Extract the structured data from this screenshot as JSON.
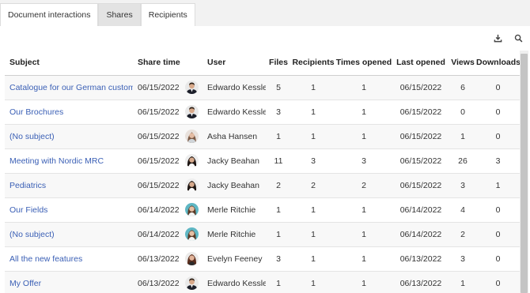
{
  "tabs": [
    {
      "label": "Document interactions",
      "active": false
    },
    {
      "label": "Shares",
      "active": true
    },
    {
      "label": "Recipients",
      "active": false
    }
  ],
  "toolbar": {
    "download_icon": "download-icon",
    "search_icon": "search-icon"
  },
  "columns": {
    "subject": "Subject",
    "share_time": "Share time",
    "user": "User",
    "files": "Files",
    "recipients": "Recipients",
    "times_opened": "Times opened",
    "last_opened": "Last opened",
    "views": "Views",
    "downloads": "Downloads"
  },
  "rows": [
    {
      "subject": "Catalogue for our German customers",
      "share_time": "06/15/2022",
      "user": "Edwardo Kessler",
      "avatar": "male-suit",
      "files": "5",
      "recipients": "1",
      "times_opened": "1",
      "last_opened": "06/15/2022",
      "views": "6",
      "downloads": "0"
    },
    {
      "subject": "Our Brochures",
      "share_time": "06/15/2022",
      "user": "Edwardo Kessler",
      "avatar": "male-suit",
      "files": "3",
      "recipients": "1",
      "times_opened": "1",
      "last_opened": "06/15/2022",
      "views": "0",
      "downloads": "0"
    },
    {
      "subject": "(No subject)",
      "share_time": "06/15/2022",
      "user": "Asha Hansen",
      "avatar": "female-light",
      "files": "1",
      "recipients": "1",
      "times_opened": "1",
      "last_opened": "06/15/2022",
      "views": "1",
      "downloads": "0"
    },
    {
      "subject": "Meeting with Nordic MRC",
      "share_time": "06/15/2022",
      "user": "Jacky Beahan",
      "avatar": "female-dark",
      "files": "11",
      "recipients": "3",
      "times_opened": "3",
      "last_opened": "06/15/2022",
      "views": "26",
      "downloads": "3"
    },
    {
      "subject": "Pediatrics",
      "share_time": "06/15/2022",
      "user": "Jacky Beahan",
      "avatar": "female-dark",
      "files": "2",
      "recipients": "2",
      "times_opened": "2",
      "last_opened": "06/15/2022",
      "views": "3",
      "downloads": "1"
    },
    {
      "subject": "Our Fields",
      "share_time": "06/14/2022",
      "user": "Merle Ritchie",
      "avatar": "female-teal",
      "files": "1",
      "recipients": "1",
      "times_opened": "1",
      "last_opened": "06/14/2022",
      "views": "4",
      "downloads": "0"
    },
    {
      "subject": "(No subject)",
      "share_time": "06/14/2022",
      "user": "Merle Ritchie",
      "avatar": "female-teal",
      "files": "1",
      "recipients": "1",
      "times_opened": "1",
      "last_opened": "06/14/2022",
      "views": "2",
      "downloads": "0"
    },
    {
      "subject": "All the new features",
      "share_time": "06/13/2022",
      "user": "Evelyn Feeney",
      "avatar": "female-brown",
      "files": "3",
      "recipients": "1",
      "times_opened": "1",
      "last_opened": "06/13/2022",
      "views": "3",
      "downloads": "0"
    },
    {
      "subject": "My Offer",
      "share_time": "06/13/2022",
      "user": "Edwardo Kessler",
      "avatar": "male-suit",
      "files": "1",
      "recipients": "1",
      "times_opened": "1",
      "last_opened": "06/13/2022",
      "views": "1",
      "downloads": "0"
    }
  ],
  "colors": {
    "link": "#3a5fb5",
    "active_tab": "#e3e3e3",
    "background": "#f2f2f2"
  }
}
